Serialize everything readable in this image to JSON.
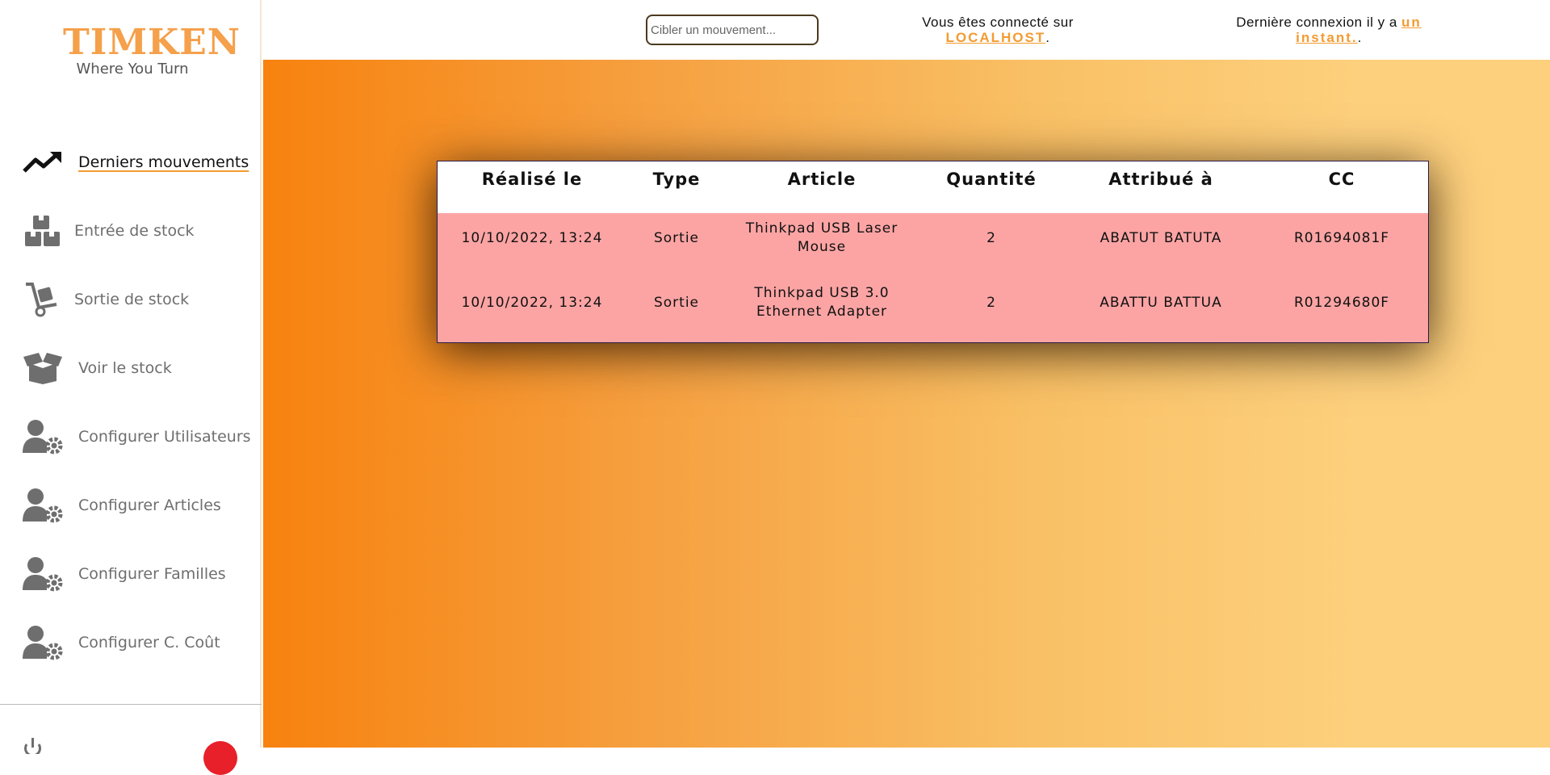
{
  "logo": {
    "brand": "TIMKEN",
    "tagline": "Where You Turn"
  },
  "sidebar": {
    "items": [
      {
        "label": "Derniers mouvements",
        "icon": "trending-up-icon",
        "active": true
      },
      {
        "label": "Entrée de stock",
        "icon": "boxes-icon",
        "active": false
      },
      {
        "label": "Sortie de stock",
        "icon": "hand-truck-icon",
        "active": false
      },
      {
        "label": "Voir le stock",
        "icon": "open-box-icon",
        "active": false
      },
      {
        "label": "Configurer Utilisateurs",
        "icon": "user-gear-icon",
        "active": false
      },
      {
        "label": "Configurer Articles",
        "icon": "user-gear-icon",
        "active": false
      },
      {
        "label": "Configurer Familles",
        "icon": "user-gear-icon",
        "active": false
      },
      {
        "label": "Configurer C. Coût",
        "icon": "user-gear-icon",
        "active": false
      }
    ]
  },
  "header": {
    "search_placeholder": "Cibler un mouvement...",
    "connected_prefix": "Vous êtes connecté sur",
    "connected_host": "LOCALHOST",
    "connected_suffix": ".",
    "last_login_prefix": "Dernière connexion il y a",
    "last_login_value_1": "un",
    "last_login_value_2": "instant.",
    "last_login_suffix": "."
  },
  "table": {
    "columns": [
      "Réalisé le",
      "Type",
      "Article",
      "Quantité",
      "Attribué à",
      "CC"
    ],
    "rows": [
      {
        "date": "10/10/2022, 13:24",
        "type": "Sortie",
        "article_1": "Thinkpad USB Laser",
        "article_2": "Mouse",
        "quantity": "2",
        "assigned": "ABATUT BATUTA",
        "cc": "R01694081F"
      },
      {
        "date": "10/10/2022, 13:24",
        "type": "Sortie",
        "article_1": "Thinkpad USB 3.0",
        "article_2": "Ethernet Adapter",
        "quantity": "2",
        "assigned": "ABATTU BATTUA",
        "cc": "R01294680F"
      }
    ]
  },
  "colors": {
    "accent": "#f39b30",
    "row_bg": "#fca4a4",
    "gradient_start": "#f7820f",
    "gradient_end": "#fdd07d"
  }
}
